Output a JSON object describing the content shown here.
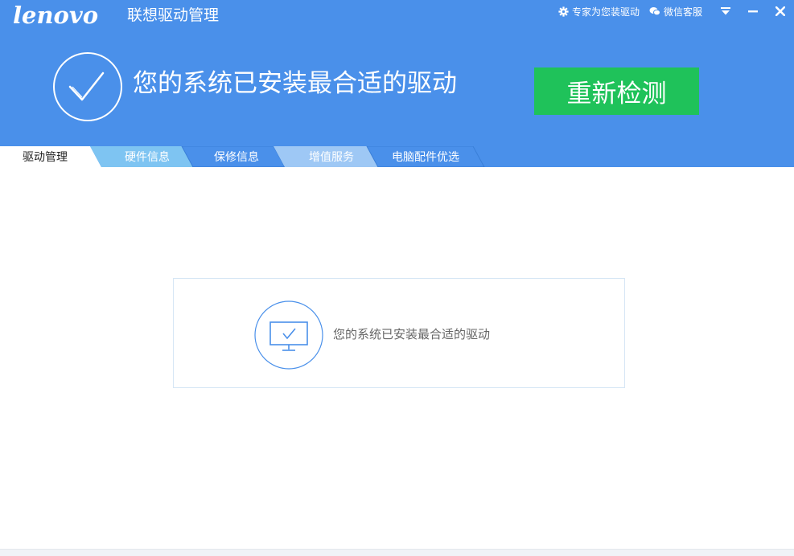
{
  "header": {
    "logo": "lenovo",
    "app_title": "联想驱动管理",
    "expert_link": "专家为您装驱动",
    "wechat_link": "微信客服",
    "status_headline": "您的系统已安装最合适的驱动",
    "recheck_label": "重新检测"
  },
  "tabs": [
    {
      "label": "驱动管理",
      "active": true
    },
    {
      "label": "硬件信息",
      "active": false
    },
    {
      "label": "保修信息",
      "active": false
    },
    {
      "label": "增值服务",
      "active": false
    },
    {
      "label": "电脑配件优选",
      "active": false
    }
  ],
  "main": {
    "result_text": "您的系统已安装最合适的驱动"
  },
  "icons": {
    "gear": "gear-icon",
    "wechat": "wechat-icon",
    "menu": "dropdown-menu-icon",
    "minimize": "minimize-icon",
    "close": "close-icon",
    "check": "check-circle-icon",
    "monitor": "monitor-check-icon"
  },
  "colors": {
    "header_bg": "#4a90ea",
    "recheck_bg": "#1fc25a",
    "tab_colors": [
      "#ffffff",
      "#7ec4f2",
      "#4a90ea",
      "#9ec8f5",
      "#4a90ea"
    ],
    "box_border": "#d6e6f5",
    "icon_blue": "#4a90ea"
  }
}
